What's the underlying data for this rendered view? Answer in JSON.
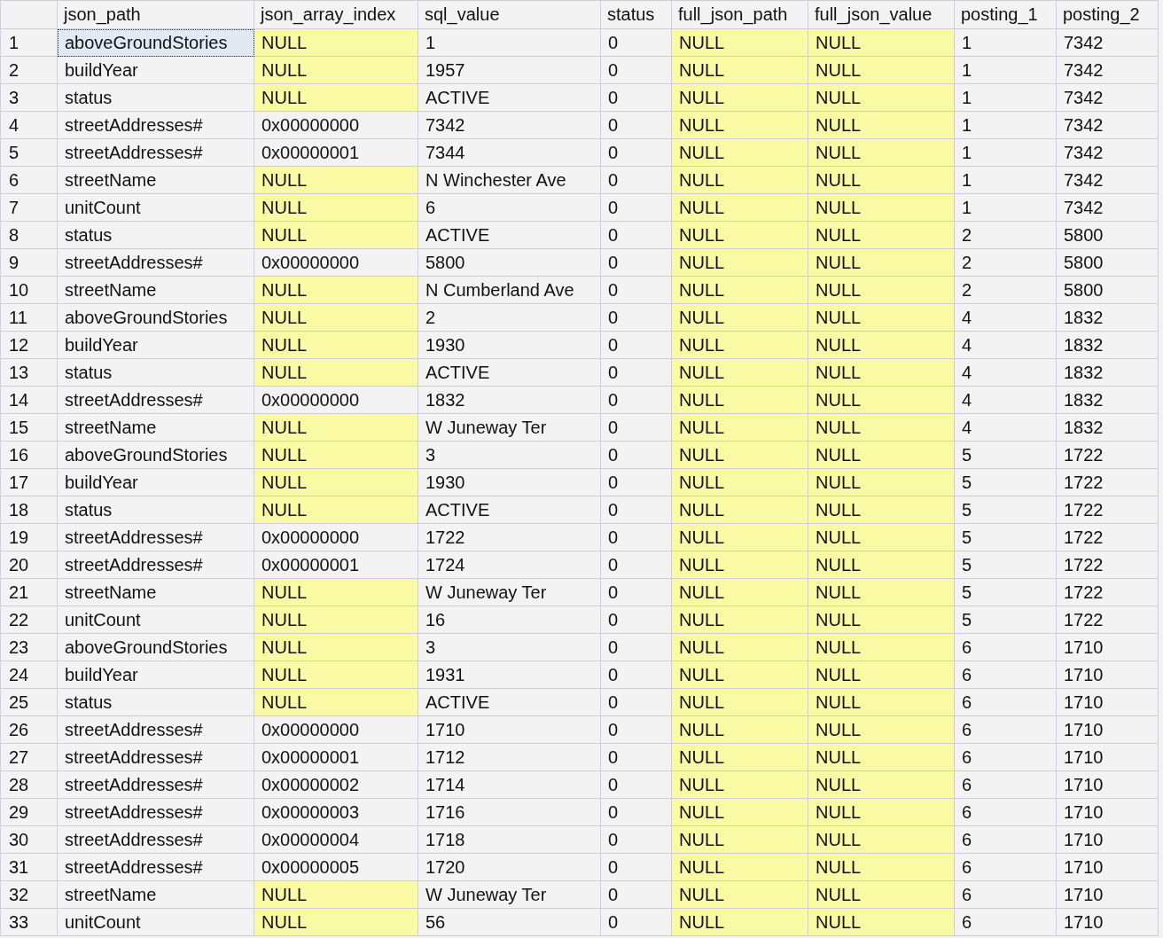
{
  "grid": {
    "columns": [
      "json_path",
      "json_array_index",
      "sql_value",
      "status",
      "full_json_path",
      "full_json_value",
      "posting_1",
      "posting_2"
    ],
    "rows": [
      {
        "number": "1",
        "cells": [
          {
            "value": "aboveGroundStories",
            "is_null": false,
            "selected": true
          },
          {
            "value": "NULL",
            "is_null": true,
            "selected": false
          },
          {
            "value": "1",
            "is_null": false,
            "selected": false
          },
          {
            "value": "0",
            "is_null": false,
            "selected": false
          },
          {
            "value": "NULL",
            "is_null": true,
            "selected": false
          },
          {
            "value": "NULL",
            "is_null": true,
            "selected": false
          },
          {
            "value": "1",
            "is_null": false,
            "selected": false
          },
          {
            "value": "7342",
            "is_null": false,
            "selected": false
          }
        ]
      },
      {
        "number": "2",
        "cells": [
          {
            "value": "buildYear",
            "is_null": false,
            "selected": false
          },
          {
            "value": "NULL",
            "is_null": true,
            "selected": false
          },
          {
            "value": "1957",
            "is_null": false,
            "selected": false
          },
          {
            "value": "0",
            "is_null": false,
            "selected": false
          },
          {
            "value": "NULL",
            "is_null": true,
            "selected": false
          },
          {
            "value": "NULL",
            "is_null": true,
            "selected": false
          },
          {
            "value": "1",
            "is_null": false,
            "selected": false
          },
          {
            "value": "7342",
            "is_null": false,
            "selected": false
          }
        ]
      },
      {
        "number": "3",
        "cells": [
          {
            "value": "status",
            "is_null": false,
            "selected": false
          },
          {
            "value": "NULL",
            "is_null": true,
            "selected": false
          },
          {
            "value": "ACTIVE",
            "is_null": false,
            "selected": false
          },
          {
            "value": "0",
            "is_null": false,
            "selected": false
          },
          {
            "value": "NULL",
            "is_null": true,
            "selected": false
          },
          {
            "value": "NULL",
            "is_null": true,
            "selected": false
          },
          {
            "value": "1",
            "is_null": false,
            "selected": false
          },
          {
            "value": "7342",
            "is_null": false,
            "selected": false
          }
        ]
      },
      {
        "number": "4",
        "cells": [
          {
            "value": "streetAddresses#",
            "is_null": false,
            "selected": false
          },
          {
            "value": "0x00000000",
            "is_null": false,
            "selected": false
          },
          {
            "value": "7342",
            "is_null": false,
            "selected": false
          },
          {
            "value": "0",
            "is_null": false,
            "selected": false
          },
          {
            "value": "NULL",
            "is_null": true,
            "selected": false
          },
          {
            "value": "NULL",
            "is_null": true,
            "selected": false
          },
          {
            "value": "1",
            "is_null": false,
            "selected": false
          },
          {
            "value": "7342",
            "is_null": false,
            "selected": false
          }
        ]
      },
      {
        "number": "5",
        "cells": [
          {
            "value": "streetAddresses#",
            "is_null": false,
            "selected": false
          },
          {
            "value": "0x00000001",
            "is_null": false,
            "selected": false
          },
          {
            "value": "7344",
            "is_null": false,
            "selected": false
          },
          {
            "value": "0",
            "is_null": false,
            "selected": false
          },
          {
            "value": "NULL",
            "is_null": true,
            "selected": false
          },
          {
            "value": "NULL",
            "is_null": true,
            "selected": false
          },
          {
            "value": "1",
            "is_null": false,
            "selected": false
          },
          {
            "value": "7342",
            "is_null": false,
            "selected": false
          }
        ]
      },
      {
        "number": "6",
        "cells": [
          {
            "value": "streetName",
            "is_null": false,
            "selected": false
          },
          {
            "value": "NULL",
            "is_null": true,
            "selected": false
          },
          {
            "value": "N Winchester Ave",
            "is_null": false,
            "selected": false
          },
          {
            "value": "0",
            "is_null": false,
            "selected": false
          },
          {
            "value": "NULL",
            "is_null": true,
            "selected": false
          },
          {
            "value": "NULL",
            "is_null": true,
            "selected": false
          },
          {
            "value": "1",
            "is_null": false,
            "selected": false
          },
          {
            "value": "7342",
            "is_null": false,
            "selected": false
          }
        ]
      },
      {
        "number": "7",
        "cells": [
          {
            "value": "unitCount",
            "is_null": false,
            "selected": false
          },
          {
            "value": "NULL",
            "is_null": true,
            "selected": false
          },
          {
            "value": "6",
            "is_null": false,
            "selected": false
          },
          {
            "value": "0",
            "is_null": false,
            "selected": false
          },
          {
            "value": "NULL",
            "is_null": true,
            "selected": false
          },
          {
            "value": "NULL",
            "is_null": true,
            "selected": false
          },
          {
            "value": "1",
            "is_null": false,
            "selected": false
          },
          {
            "value": "7342",
            "is_null": false,
            "selected": false
          }
        ]
      },
      {
        "number": "8",
        "cells": [
          {
            "value": "status",
            "is_null": false,
            "selected": false
          },
          {
            "value": "NULL",
            "is_null": true,
            "selected": false
          },
          {
            "value": "ACTIVE",
            "is_null": false,
            "selected": false
          },
          {
            "value": "0",
            "is_null": false,
            "selected": false
          },
          {
            "value": "NULL",
            "is_null": true,
            "selected": false
          },
          {
            "value": "NULL",
            "is_null": true,
            "selected": false
          },
          {
            "value": "2",
            "is_null": false,
            "selected": false
          },
          {
            "value": "5800",
            "is_null": false,
            "selected": false
          }
        ]
      },
      {
        "number": "9",
        "cells": [
          {
            "value": "streetAddresses#",
            "is_null": false,
            "selected": false
          },
          {
            "value": "0x00000000",
            "is_null": false,
            "selected": false
          },
          {
            "value": "5800",
            "is_null": false,
            "selected": false
          },
          {
            "value": "0",
            "is_null": false,
            "selected": false
          },
          {
            "value": "NULL",
            "is_null": true,
            "selected": false
          },
          {
            "value": "NULL",
            "is_null": true,
            "selected": false
          },
          {
            "value": "2",
            "is_null": false,
            "selected": false
          },
          {
            "value": "5800",
            "is_null": false,
            "selected": false
          }
        ]
      },
      {
        "number": "10",
        "cells": [
          {
            "value": "streetName",
            "is_null": false,
            "selected": false
          },
          {
            "value": "NULL",
            "is_null": true,
            "selected": false
          },
          {
            "value": "N Cumberland Ave",
            "is_null": false,
            "selected": false
          },
          {
            "value": "0",
            "is_null": false,
            "selected": false
          },
          {
            "value": "NULL",
            "is_null": true,
            "selected": false
          },
          {
            "value": "NULL",
            "is_null": true,
            "selected": false
          },
          {
            "value": "2",
            "is_null": false,
            "selected": false
          },
          {
            "value": "5800",
            "is_null": false,
            "selected": false
          }
        ]
      },
      {
        "number": "11",
        "cells": [
          {
            "value": "aboveGroundStories",
            "is_null": false,
            "selected": false
          },
          {
            "value": "NULL",
            "is_null": true,
            "selected": false
          },
          {
            "value": "2",
            "is_null": false,
            "selected": false
          },
          {
            "value": "0",
            "is_null": false,
            "selected": false
          },
          {
            "value": "NULL",
            "is_null": true,
            "selected": false
          },
          {
            "value": "NULL",
            "is_null": true,
            "selected": false
          },
          {
            "value": "4",
            "is_null": false,
            "selected": false
          },
          {
            "value": "1832",
            "is_null": false,
            "selected": false
          }
        ]
      },
      {
        "number": "12",
        "cells": [
          {
            "value": "buildYear",
            "is_null": false,
            "selected": false
          },
          {
            "value": "NULL",
            "is_null": true,
            "selected": false
          },
          {
            "value": "1930",
            "is_null": false,
            "selected": false
          },
          {
            "value": "0",
            "is_null": false,
            "selected": false
          },
          {
            "value": "NULL",
            "is_null": true,
            "selected": false
          },
          {
            "value": "NULL",
            "is_null": true,
            "selected": false
          },
          {
            "value": "4",
            "is_null": false,
            "selected": false
          },
          {
            "value": "1832",
            "is_null": false,
            "selected": false
          }
        ]
      },
      {
        "number": "13",
        "cells": [
          {
            "value": "status",
            "is_null": false,
            "selected": false
          },
          {
            "value": "NULL",
            "is_null": true,
            "selected": false
          },
          {
            "value": "ACTIVE",
            "is_null": false,
            "selected": false
          },
          {
            "value": "0",
            "is_null": false,
            "selected": false
          },
          {
            "value": "NULL",
            "is_null": true,
            "selected": false
          },
          {
            "value": "NULL",
            "is_null": true,
            "selected": false
          },
          {
            "value": "4",
            "is_null": false,
            "selected": false
          },
          {
            "value": "1832",
            "is_null": false,
            "selected": false
          }
        ]
      },
      {
        "number": "14",
        "cells": [
          {
            "value": "streetAddresses#",
            "is_null": false,
            "selected": false
          },
          {
            "value": "0x00000000",
            "is_null": false,
            "selected": false
          },
          {
            "value": "1832",
            "is_null": false,
            "selected": false
          },
          {
            "value": "0",
            "is_null": false,
            "selected": false
          },
          {
            "value": "NULL",
            "is_null": true,
            "selected": false
          },
          {
            "value": "NULL",
            "is_null": true,
            "selected": false
          },
          {
            "value": "4",
            "is_null": false,
            "selected": false
          },
          {
            "value": "1832",
            "is_null": false,
            "selected": false
          }
        ]
      },
      {
        "number": "15",
        "cells": [
          {
            "value": "streetName",
            "is_null": false,
            "selected": false
          },
          {
            "value": "NULL",
            "is_null": true,
            "selected": false
          },
          {
            "value": "W Juneway Ter",
            "is_null": false,
            "selected": false
          },
          {
            "value": "0",
            "is_null": false,
            "selected": false
          },
          {
            "value": "NULL",
            "is_null": true,
            "selected": false
          },
          {
            "value": "NULL",
            "is_null": true,
            "selected": false
          },
          {
            "value": "4",
            "is_null": false,
            "selected": false
          },
          {
            "value": "1832",
            "is_null": false,
            "selected": false
          }
        ]
      },
      {
        "number": "16",
        "cells": [
          {
            "value": "aboveGroundStories",
            "is_null": false,
            "selected": false
          },
          {
            "value": "NULL",
            "is_null": true,
            "selected": false
          },
          {
            "value": "3",
            "is_null": false,
            "selected": false
          },
          {
            "value": "0",
            "is_null": false,
            "selected": false
          },
          {
            "value": "NULL",
            "is_null": true,
            "selected": false
          },
          {
            "value": "NULL",
            "is_null": true,
            "selected": false
          },
          {
            "value": "5",
            "is_null": false,
            "selected": false
          },
          {
            "value": "1722",
            "is_null": false,
            "selected": false
          }
        ]
      },
      {
        "number": "17",
        "cells": [
          {
            "value": "buildYear",
            "is_null": false,
            "selected": false
          },
          {
            "value": "NULL",
            "is_null": true,
            "selected": false
          },
          {
            "value": "1930",
            "is_null": false,
            "selected": false
          },
          {
            "value": "0",
            "is_null": false,
            "selected": false
          },
          {
            "value": "NULL",
            "is_null": true,
            "selected": false
          },
          {
            "value": "NULL",
            "is_null": true,
            "selected": false
          },
          {
            "value": "5",
            "is_null": false,
            "selected": false
          },
          {
            "value": "1722",
            "is_null": false,
            "selected": false
          }
        ]
      },
      {
        "number": "18",
        "cells": [
          {
            "value": "status",
            "is_null": false,
            "selected": false
          },
          {
            "value": "NULL",
            "is_null": true,
            "selected": false
          },
          {
            "value": "ACTIVE",
            "is_null": false,
            "selected": false
          },
          {
            "value": "0",
            "is_null": false,
            "selected": false
          },
          {
            "value": "NULL",
            "is_null": true,
            "selected": false
          },
          {
            "value": "NULL",
            "is_null": true,
            "selected": false
          },
          {
            "value": "5",
            "is_null": false,
            "selected": false
          },
          {
            "value": "1722",
            "is_null": false,
            "selected": false
          }
        ]
      },
      {
        "number": "19",
        "cells": [
          {
            "value": "streetAddresses#",
            "is_null": false,
            "selected": false
          },
          {
            "value": "0x00000000",
            "is_null": false,
            "selected": false
          },
          {
            "value": "1722",
            "is_null": false,
            "selected": false
          },
          {
            "value": "0",
            "is_null": false,
            "selected": false
          },
          {
            "value": "NULL",
            "is_null": true,
            "selected": false
          },
          {
            "value": "NULL",
            "is_null": true,
            "selected": false
          },
          {
            "value": "5",
            "is_null": false,
            "selected": false
          },
          {
            "value": "1722",
            "is_null": false,
            "selected": false
          }
        ]
      },
      {
        "number": "20",
        "cells": [
          {
            "value": "streetAddresses#",
            "is_null": false,
            "selected": false
          },
          {
            "value": "0x00000001",
            "is_null": false,
            "selected": false
          },
          {
            "value": "1724",
            "is_null": false,
            "selected": false
          },
          {
            "value": "0",
            "is_null": false,
            "selected": false
          },
          {
            "value": "NULL",
            "is_null": true,
            "selected": false
          },
          {
            "value": "NULL",
            "is_null": true,
            "selected": false
          },
          {
            "value": "5",
            "is_null": false,
            "selected": false
          },
          {
            "value": "1722",
            "is_null": false,
            "selected": false
          }
        ]
      },
      {
        "number": "21",
        "cells": [
          {
            "value": "streetName",
            "is_null": false,
            "selected": false
          },
          {
            "value": "NULL",
            "is_null": true,
            "selected": false
          },
          {
            "value": "W Juneway Ter",
            "is_null": false,
            "selected": false
          },
          {
            "value": "0",
            "is_null": false,
            "selected": false
          },
          {
            "value": "NULL",
            "is_null": true,
            "selected": false
          },
          {
            "value": "NULL",
            "is_null": true,
            "selected": false
          },
          {
            "value": "5",
            "is_null": false,
            "selected": false
          },
          {
            "value": "1722",
            "is_null": false,
            "selected": false
          }
        ]
      },
      {
        "number": "22",
        "cells": [
          {
            "value": "unitCount",
            "is_null": false,
            "selected": false
          },
          {
            "value": "NULL",
            "is_null": true,
            "selected": false
          },
          {
            "value": "16",
            "is_null": false,
            "selected": false
          },
          {
            "value": "0",
            "is_null": false,
            "selected": false
          },
          {
            "value": "NULL",
            "is_null": true,
            "selected": false
          },
          {
            "value": "NULL",
            "is_null": true,
            "selected": false
          },
          {
            "value": "5",
            "is_null": false,
            "selected": false
          },
          {
            "value": "1722",
            "is_null": false,
            "selected": false
          }
        ]
      },
      {
        "number": "23",
        "cells": [
          {
            "value": "aboveGroundStories",
            "is_null": false,
            "selected": false
          },
          {
            "value": "NULL",
            "is_null": true,
            "selected": false
          },
          {
            "value": "3",
            "is_null": false,
            "selected": false
          },
          {
            "value": "0",
            "is_null": false,
            "selected": false
          },
          {
            "value": "NULL",
            "is_null": true,
            "selected": false
          },
          {
            "value": "NULL",
            "is_null": true,
            "selected": false
          },
          {
            "value": "6",
            "is_null": false,
            "selected": false
          },
          {
            "value": "1710",
            "is_null": false,
            "selected": false
          }
        ]
      },
      {
        "number": "24",
        "cells": [
          {
            "value": "buildYear",
            "is_null": false,
            "selected": false
          },
          {
            "value": "NULL",
            "is_null": true,
            "selected": false
          },
          {
            "value": "1931",
            "is_null": false,
            "selected": false
          },
          {
            "value": "0",
            "is_null": false,
            "selected": false
          },
          {
            "value": "NULL",
            "is_null": true,
            "selected": false
          },
          {
            "value": "NULL",
            "is_null": true,
            "selected": false
          },
          {
            "value": "6",
            "is_null": false,
            "selected": false
          },
          {
            "value": "1710",
            "is_null": false,
            "selected": false
          }
        ]
      },
      {
        "number": "25",
        "cells": [
          {
            "value": "status",
            "is_null": false,
            "selected": false
          },
          {
            "value": "NULL",
            "is_null": true,
            "selected": false
          },
          {
            "value": "ACTIVE",
            "is_null": false,
            "selected": false
          },
          {
            "value": "0",
            "is_null": false,
            "selected": false
          },
          {
            "value": "NULL",
            "is_null": true,
            "selected": false
          },
          {
            "value": "NULL",
            "is_null": true,
            "selected": false
          },
          {
            "value": "6",
            "is_null": false,
            "selected": false
          },
          {
            "value": "1710",
            "is_null": false,
            "selected": false
          }
        ]
      },
      {
        "number": "26",
        "cells": [
          {
            "value": "streetAddresses#",
            "is_null": false,
            "selected": false
          },
          {
            "value": "0x00000000",
            "is_null": false,
            "selected": false
          },
          {
            "value": "1710",
            "is_null": false,
            "selected": false
          },
          {
            "value": "0",
            "is_null": false,
            "selected": false
          },
          {
            "value": "NULL",
            "is_null": true,
            "selected": false
          },
          {
            "value": "NULL",
            "is_null": true,
            "selected": false
          },
          {
            "value": "6",
            "is_null": false,
            "selected": false
          },
          {
            "value": "1710",
            "is_null": false,
            "selected": false
          }
        ]
      },
      {
        "number": "27",
        "cells": [
          {
            "value": "streetAddresses#",
            "is_null": false,
            "selected": false
          },
          {
            "value": "0x00000001",
            "is_null": false,
            "selected": false
          },
          {
            "value": "1712",
            "is_null": false,
            "selected": false
          },
          {
            "value": "0",
            "is_null": false,
            "selected": false
          },
          {
            "value": "NULL",
            "is_null": true,
            "selected": false
          },
          {
            "value": "NULL",
            "is_null": true,
            "selected": false
          },
          {
            "value": "6",
            "is_null": false,
            "selected": false
          },
          {
            "value": "1710",
            "is_null": false,
            "selected": false
          }
        ]
      },
      {
        "number": "28",
        "cells": [
          {
            "value": "streetAddresses#",
            "is_null": false,
            "selected": false
          },
          {
            "value": "0x00000002",
            "is_null": false,
            "selected": false
          },
          {
            "value": "1714",
            "is_null": false,
            "selected": false
          },
          {
            "value": "0",
            "is_null": false,
            "selected": false
          },
          {
            "value": "NULL",
            "is_null": true,
            "selected": false
          },
          {
            "value": "NULL",
            "is_null": true,
            "selected": false
          },
          {
            "value": "6",
            "is_null": false,
            "selected": false
          },
          {
            "value": "1710",
            "is_null": false,
            "selected": false
          }
        ]
      },
      {
        "number": "29",
        "cells": [
          {
            "value": "streetAddresses#",
            "is_null": false,
            "selected": false
          },
          {
            "value": "0x00000003",
            "is_null": false,
            "selected": false
          },
          {
            "value": "1716",
            "is_null": false,
            "selected": false
          },
          {
            "value": "0",
            "is_null": false,
            "selected": false
          },
          {
            "value": "NULL",
            "is_null": true,
            "selected": false
          },
          {
            "value": "NULL",
            "is_null": true,
            "selected": false
          },
          {
            "value": "6",
            "is_null": false,
            "selected": false
          },
          {
            "value": "1710",
            "is_null": false,
            "selected": false
          }
        ]
      },
      {
        "number": "30",
        "cells": [
          {
            "value": "streetAddresses#",
            "is_null": false,
            "selected": false
          },
          {
            "value": "0x00000004",
            "is_null": false,
            "selected": false
          },
          {
            "value": "1718",
            "is_null": false,
            "selected": false
          },
          {
            "value": "0",
            "is_null": false,
            "selected": false
          },
          {
            "value": "NULL",
            "is_null": true,
            "selected": false
          },
          {
            "value": "NULL",
            "is_null": true,
            "selected": false
          },
          {
            "value": "6",
            "is_null": false,
            "selected": false
          },
          {
            "value": "1710",
            "is_null": false,
            "selected": false
          }
        ]
      },
      {
        "number": "31",
        "cells": [
          {
            "value": "streetAddresses#",
            "is_null": false,
            "selected": false
          },
          {
            "value": "0x00000005",
            "is_null": false,
            "selected": false
          },
          {
            "value": "1720",
            "is_null": false,
            "selected": false
          },
          {
            "value": "0",
            "is_null": false,
            "selected": false
          },
          {
            "value": "NULL",
            "is_null": true,
            "selected": false
          },
          {
            "value": "NULL",
            "is_null": true,
            "selected": false
          },
          {
            "value": "6",
            "is_null": false,
            "selected": false
          },
          {
            "value": "1710",
            "is_null": false,
            "selected": false
          }
        ]
      },
      {
        "number": "32",
        "cells": [
          {
            "value": "streetName",
            "is_null": false,
            "selected": false
          },
          {
            "value": "NULL",
            "is_null": true,
            "selected": false
          },
          {
            "value": "W Juneway Ter",
            "is_null": false,
            "selected": false
          },
          {
            "value": "0",
            "is_null": false,
            "selected": false
          },
          {
            "value": "NULL",
            "is_null": true,
            "selected": false
          },
          {
            "value": "NULL",
            "is_null": true,
            "selected": false
          },
          {
            "value": "6",
            "is_null": false,
            "selected": false
          },
          {
            "value": "1710",
            "is_null": false,
            "selected": false
          }
        ]
      },
      {
        "number": "33",
        "cells": [
          {
            "value": "unitCount",
            "is_null": false,
            "selected": false
          },
          {
            "value": "NULL",
            "is_null": true,
            "selected": false
          },
          {
            "value": "56",
            "is_null": false,
            "selected": false
          },
          {
            "value": "0",
            "is_null": false,
            "selected": false
          },
          {
            "value": "NULL",
            "is_null": true,
            "selected": false
          },
          {
            "value": "NULL",
            "is_null": true,
            "selected": false
          },
          {
            "value": "6",
            "is_null": false,
            "selected": false
          },
          {
            "value": "1710",
            "is_null": false,
            "selected": false
          }
        ]
      }
    ]
  }
}
